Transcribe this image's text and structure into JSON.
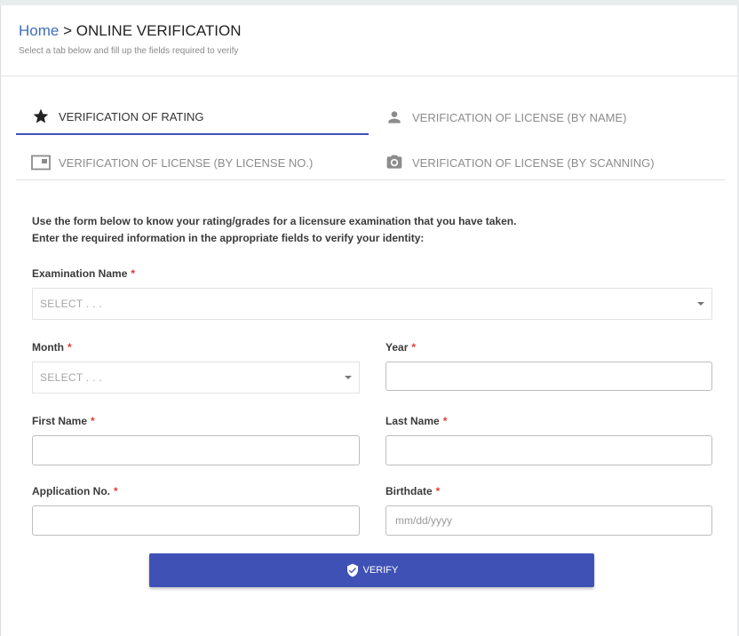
{
  "header": {
    "home_link": "Home",
    "separator": " > ",
    "title": "ONLINE VERIFICATION",
    "subtitle": "Select a tab below and fill up the fields required to verify"
  },
  "tabs": [
    {
      "label": "VERIFICATION OF RATING",
      "icon": "star-icon",
      "active": true
    },
    {
      "label": "VERIFICATION OF LICENSE (BY NAME)",
      "icon": "person-icon",
      "active": false
    },
    {
      "label": "VERIFICATION OF LICENSE (BY LICENSE NO.)",
      "icon": "card-icon",
      "active": false
    },
    {
      "label": "VERIFICATION OF LICENSE (BY SCANNING)",
      "icon": "camera-icon",
      "active": false
    }
  ],
  "form": {
    "intro_line1": "Use the form below to know your rating/grades for a licensure examination that you have taken.",
    "intro_line2": "Enter the required information in the appropriate fields to verify your identity:",
    "required_marker": "*",
    "exam_name": {
      "label": "Examination Name",
      "value": "SELECT . . ."
    },
    "month": {
      "label": "Month",
      "value": "SELECT . . ."
    },
    "year": {
      "label": "Year",
      "value": "",
      "placeholder": ""
    },
    "first_name": {
      "label": "First Name",
      "value": "",
      "placeholder": ""
    },
    "last_name": {
      "label": "Last Name",
      "value": "",
      "placeholder": ""
    },
    "application_no": {
      "label": "Application No.",
      "value": "",
      "placeholder": ""
    },
    "birthdate": {
      "label": "Birthdate",
      "value": "",
      "placeholder": "mm/dd/yyyy"
    },
    "verify_label": "VERIFY"
  },
  "colors": {
    "accent": "#3f51b5",
    "link": "#3f6fb5",
    "required": "#e53935"
  }
}
